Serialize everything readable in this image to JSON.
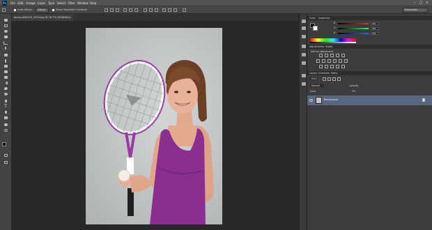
{
  "app": {
    "logo": "Ps",
    "menu": [
      "File",
      "Edit",
      "Image",
      "Layer",
      "Type",
      "Select",
      "Filter",
      "Window",
      "Help"
    ],
    "window_controls": [
      "–",
      "□",
      "×"
    ]
  },
  "options_bar": {
    "auto_select_label": "Auto-Select:",
    "auto_select_value": "Group",
    "show_transform_label": "Show Transform Controls",
    "workspace": "Essentials"
  },
  "document": {
    "tab_title": "tennis-849123_1920.jpg @ 16.7% (RGB/8#)",
    "close": "×"
  },
  "panels": {
    "color": {
      "tabs": [
        "Color",
        "Swatches"
      ],
      "channels": [
        {
          "label": "R",
          "value": "255",
          "color": "#e23b3b"
        },
        {
          "label": "G",
          "value": "255",
          "color": "#3bbf55"
        },
        {
          "label": "B",
          "value": "255",
          "color": "#3f6fe0"
        }
      ]
    },
    "adjustments": {
      "tabs": [
        "Adjustments",
        "Styles"
      ],
      "heading": "Add an adjustment"
    },
    "layers": {
      "tabs": [
        "Layers",
        "Channels",
        "Paths"
      ],
      "kind_label": "Kind",
      "blend_mode": "Normal",
      "opacity_label": "Opacity:",
      "lock_label": "Lock:",
      "fill_label": "Fill:",
      "layer_name": "Background"
    }
  },
  "icons": {
    "toolbox": [
      "move-icon",
      "marquee-icon",
      "lasso-icon",
      "quick-select-icon",
      "crop-icon",
      "eyedropper-icon",
      "healing-icon",
      "brush-icon",
      "clone-stamp-icon",
      "history-brush-icon",
      "eraser-icon",
      "gradient-icon",
      "blur-icon",
      "dodge-icon",
      "pen-icon",
      "type-icon",
      "path-select-icon",
      "shape-icon",
      "hand-icon",
      "zoom-icon"
    ],
    "dock": [
      "history-icon",
      "properties-icon",
      "character-icon",
      "paragraph-icon",
      "info-icon",
      "brush-preset-icon"
    ]
  },
  "colors": {
    "app_bg": "#282828",
    "panel_bg": "#3c3c3c",
    "selected_layer": "#596680",
    "tank_top": "#8a2f8f"
  }
}
